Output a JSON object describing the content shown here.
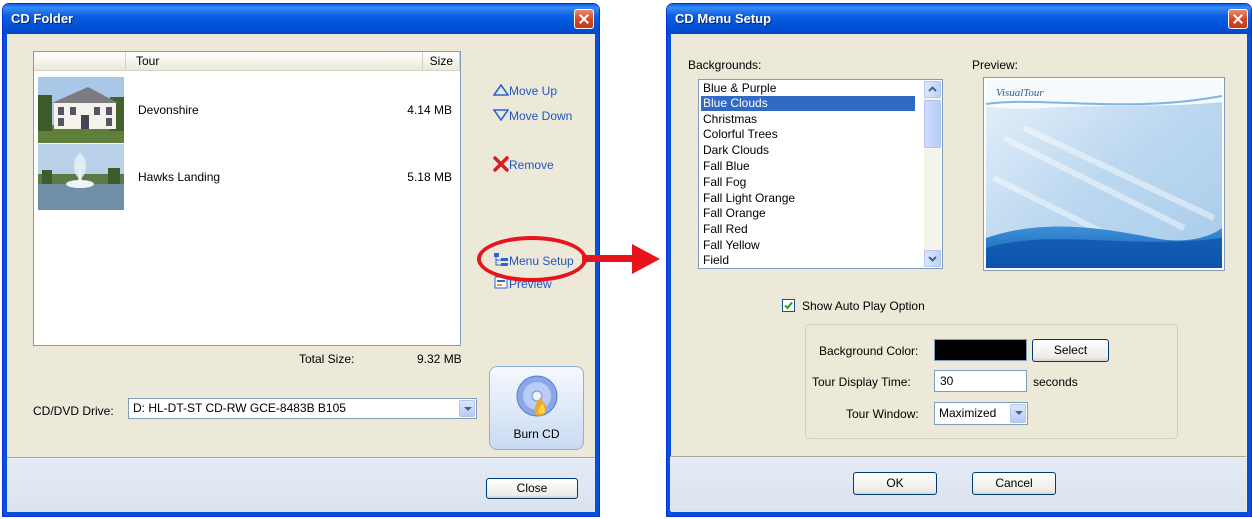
{
  "cd_folder": {
    "title": "CD Folder",
    "columns": {
      "tour": "Tour",
      "size": "Size"
    },
    "tours": [
      {
        "name": "Devonshire",
        "size": "4.14 MB"
      },
      {
        "name": "Hawks Landing",
        "size": "5.18 MB"
      }
    ],
    "actions": {
      "move_up": "Move Up",
      "move_down": "Move Down",
      "remove": "Remove",
      "menu_setup": "Menu Setup",
      "preview": "Preview"
    },
    "total_size_label": "Total Size:",
    "total_size_value": "9.32 MB",
    "drive_label": "CD/DVD Drive:",
    "drive_value": "D: HL-DT-ST CD-RW GCE-8483B B105",
    "burn_label": "Burn CD",
    "close_label": "Close"
  },
  "menu_setup": {
    "title": "CD Menu Setup",
    "backgrounds_label": "Backgrounds:",
    "preview_label": "Preview:",
    "preview_logo": "VisualTour",
    "backgrounds": [
      "Blue & Purple",
      "Blue Clouds",
      "Christmas",
      "Colorful Trees",
      "Dark Clouds",
      "Fall Blue",
      "Fall Fog",
      "Fall Light Orange",
      "Fall Orange",
      "Fall Red",
      "Fall Yellow",
      "Field"
    ],
    "selected_background": "Blue Clouds",
    "autoplay_label": "Show Auto Play Option",
    "autoplay_checked": true,
    "bg_color_label": "Background Color:",
    "bg_color_value": "#000000",
    "select_label": "Select",
    "display_time_label": "Tour Display Time:",
    "display_time_value": "30",
    "display_time_unit": "seconds",
    "tour_window_label": "Tour Window:",
    "tour_window_value": "Maximized",
    "ok_label": "OK",
    "cancel_label": "Cancel"
  },
  "annotation": {
    "highlight_color": "#e8141b"
  }
}
